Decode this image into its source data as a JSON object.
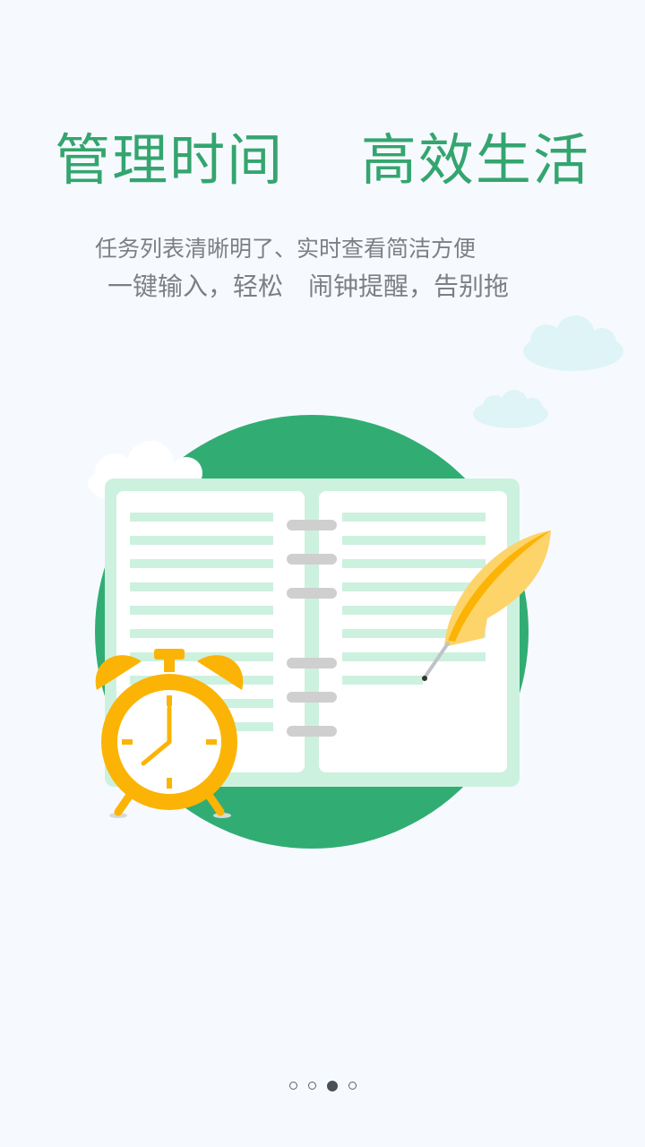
{
  "intro": {
    "title": "管理时间　 高效生活",
    "line1": "任务列表清晰明了、实时查看简洁方便",
    "line2": "一键输入，轻松　闹钟提醒，告别拖"
  },
  "pager": {
    "page_count": 4,
    "current_page": 3
  },
  "colors": {
    "accent": "#34a56f",
    "circle": "#31ad73",
    "notebook": "#cdf1df",
    "clock": "#fbb406",
    "quill": "#fdd46a"
  },
  "icons": [
    "cloud-icon",
    "notebook-icon",
    "alarm-clock-icon",
    "quill-pen-icon"
  ]
}
